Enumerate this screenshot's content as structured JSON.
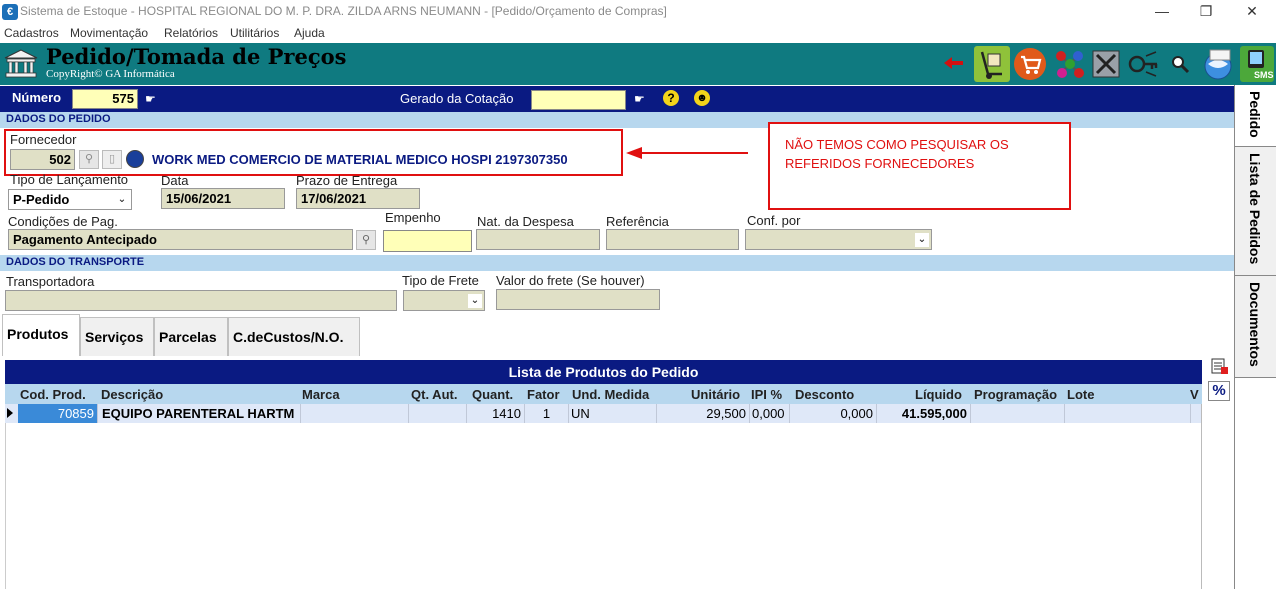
{
  "window": {
    "title": "Sistema de Estoque - HOSPITAL REGIONAL DO M. P. DRA. ZILDA ARNS NEUMANN - [Pedido/Orçamento de Compras]",
    "minimize": "—",
    "restore": "❐",
    "close": "✕"
  },
  "menu": [
    "Cadastros",
    "Movimentação",
    "Relatórios",
    "Utilitários",
    "Ajuda"
  ],
  "banner": {
    "title": "Pedido/Tomada de Preços",
    "subtitle": "CopyRight© GA Informática",
    "sms_label": "SMS",
    "icons": [
      "back-arrow-icon",
      "hand-truck-icon",
      "shopping-cart-icon",
      "molecule-icon",
      "tools-icon",
      "key-icon",
      "magnifier-icon",
      "globe-icon",
      "sms-icon"
    ]
  },
  "right_tabs": [
    "Pedido",
    "Lista de Pedidos",
    "Documentos"
  ],
  "numero": {
    "label": "Número",
    "value": "575",
    "gerado_label": "Gerado da Cotação",
    "gerado_value": ""
  },
  "dados_pedido": {
    "section_title": "DADOS DO PEDIDO",
    "fornecedor_label": "Fornecedor",
    "fornecedor_code": "502",
    "fornecedor_name": "WORK MED COMERCIO DE MATERIAL MEDICO HOSPI  2197307350",
    "tipo_label": "Tipo de Lançamento",
    "tipo_value": "P-Pedido",
    "data_label": "Data",
    "data_value": "15/06/2021",
    "prazo_label": "Prazo de Entrega",
    "prazo_value": "17/06/2021",
    "condicoes_label": "Condições de Pag.",
    "condicoes_value": "Pagamento Antecipado",
    "empenho_label": "Empenho",
    "empenho_value": "",
    "nat_label": "Nat. da Despesa",
    "nat_value": "",
    "referencia_label": "Referência",
    "referencia_value": "",
    "conf_label": "Conf. por",
    "conf_value": ""
  },
  "annotation": {
    "text": "NÃO TEMOS COMO PESQUISAR OS REFERIDOS FORNECEDORES",
    "color": "#e01010"
  },
  "transporte": {
    "section_title": "DADOS DO TRANSPORTE",
    "transportadora_label": "Transportadora",
    "transportadora_value": "",
    "frete_label": "Tipo de Frete",
    "frete_value": "",
    "valor_label": "Valor do frete (Se houver)",
    "valor_value": ""
  },
  "tabs": [
    "Produtos",
    "Serviços",
    "Parcelas",
    "C.deCustos/N.O."
  ],
  "grid": {
    "title": "Lista de Produtos do Pedido",
    "percent_button": "%",
    "columns": [
      "Cod. Prod.",
      "Descrição",
      "Marca",
      "Qt. Aut.",
      "Quant.",
      "Fator",
      "Und. Medida",
      "Unitário",
      "IPI %",
      "Desconto",
      "Líquido",
      "Programação",
      "Lote",
      "V"
    ],
    "rows": [
      {
        "cod": "70859",
        "descricao": "EQUIPO PARENTERAL HARTM",
        "marca": "",
        "qt_aut": "",
        "quant": "1410",
        "fator": "1",
        "und": "UN",
        "unitario": "29,500",
        "ipi": "0,000",
        "desconto": "0,000",
        "liquido": "41.595,000",
        "programacao": "",
        "lote": ""
      }
    ]
  },
  "colors": {
    "banner_bg": "#0f7a80",
    "navy": "#0a1a82",
    "section_bg": "#b7d7ee",
    "field_bg": "#e0e0c6",
    "yellow_field": "#ffffb8"
  }
}
